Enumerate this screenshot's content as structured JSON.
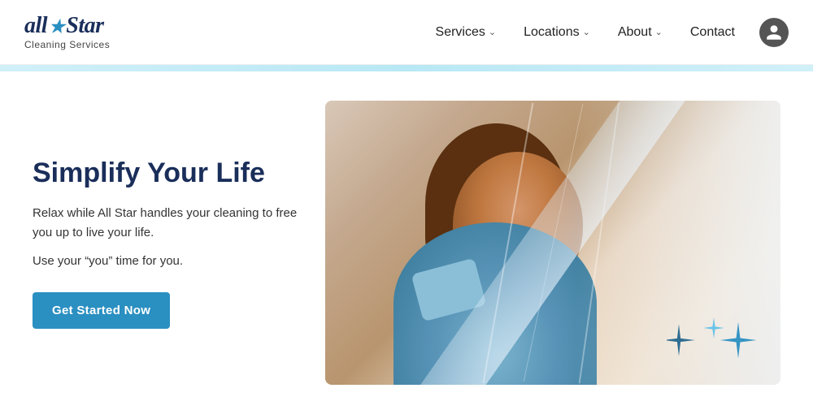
{
  "logo": {
    "title_part1": "all",
    "title_star": "★",
    "title_part2": "Star",
    "subtitle": "Cleaning Services"
  },
  "nav": {
    "services_label": "Services",
    "locations_label": "Locations",
    "about_label": "About",
    "contact_label": "Contact",
    "chevron": "∨"
  },
  "hero": {
    "heading": "Simplify Your Life",
    "body_text": "Relax while All Star handles your cleaning to free you up to live your life.",
    "sub_text": "Use your “you” time for you.",
    "cta_label": "Get Started Now"
  }
}
